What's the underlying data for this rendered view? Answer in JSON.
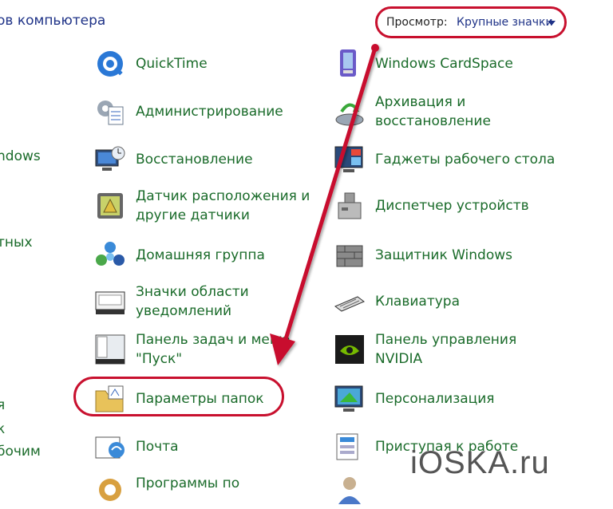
{
  "header": {
    "title_fragment": "ов компьютера",
    "view_label": "Просмотр:",
    "view_value": "Крупные значки"
  },
  "cut_left_items": [
    "ndows",
    "тных",
    "я",
    "к",
    "бочим"
  ],
  "col1": [
    {
      "label": "QuickTime",
      "icon": "quicktime-icon"
    },
    {
      "label": "Администрирование",
      "icon": "admin-tools-icon"
    },
    {
      "label": "Восстановление",
      "icon": "recovery-icon"
    },
    {
      "label": "Датчик расположения и\nдругие датчики",
      "icon": "location-sensor-icon"
    },
    {
      "label": "Домашняя группа",
      "icon": "homegroup-icon"
    },
    {
      "label": "Значки области\nуведомлений",
      "icon": "notification-icons-icon"
    },
    {
      "label": "Панель задач и меню\n\"Пуск\"",
      "icon": "taskbar-icon"
    },
    {
      "label": "Параметры папок",
      "icon": "folder-options-icon"
    },
    {
      "label": "Почта",
      "icon": "mail-icon"
    },
    {
      "label": "Программы по",
      "icon": "default-programs-icon"
    }
  ],
  "col2": [
    {
      "label": "Windows CardSpace",
      "icon": "cardspace-icon"
    },
    {
      "label": "Архивация и\nвосстановление",
      "icon": "backup-icon"
    },
    {
      "label": "Гаджеты рабочего стола",
      "icon": "gadgets-icon"
    },
    {
      "label": "Диспетчер устройств",
      "icon": "device-manager-icon"
    },
    {
      "label": "Защитник Windows",
      "icon": "defender-icon"
    },
    {
      "label": "Клавиатура",
      "icon": "keyboard-icon"
    },
    {
      "label": "Панель управления\nNVIDIA",
      "icon": "nvidia-icon"
    },
    {
      "label": "Персонализация",
      "icon": "personalization-icon"
    },
    {
      "label": "Приступая к работе",
      "icon": "getting-started-icon"
    },
    {
      "label": "",
      "icon": "user-accounts-icon"
    }
  ],
  "watermark": "iOSKA.ru",
  "colors": {
    "link_green": "#1a6b2a",
    "highlight_red": "#c8102e",
    "title_blue": "#1e3287"
  }
}
